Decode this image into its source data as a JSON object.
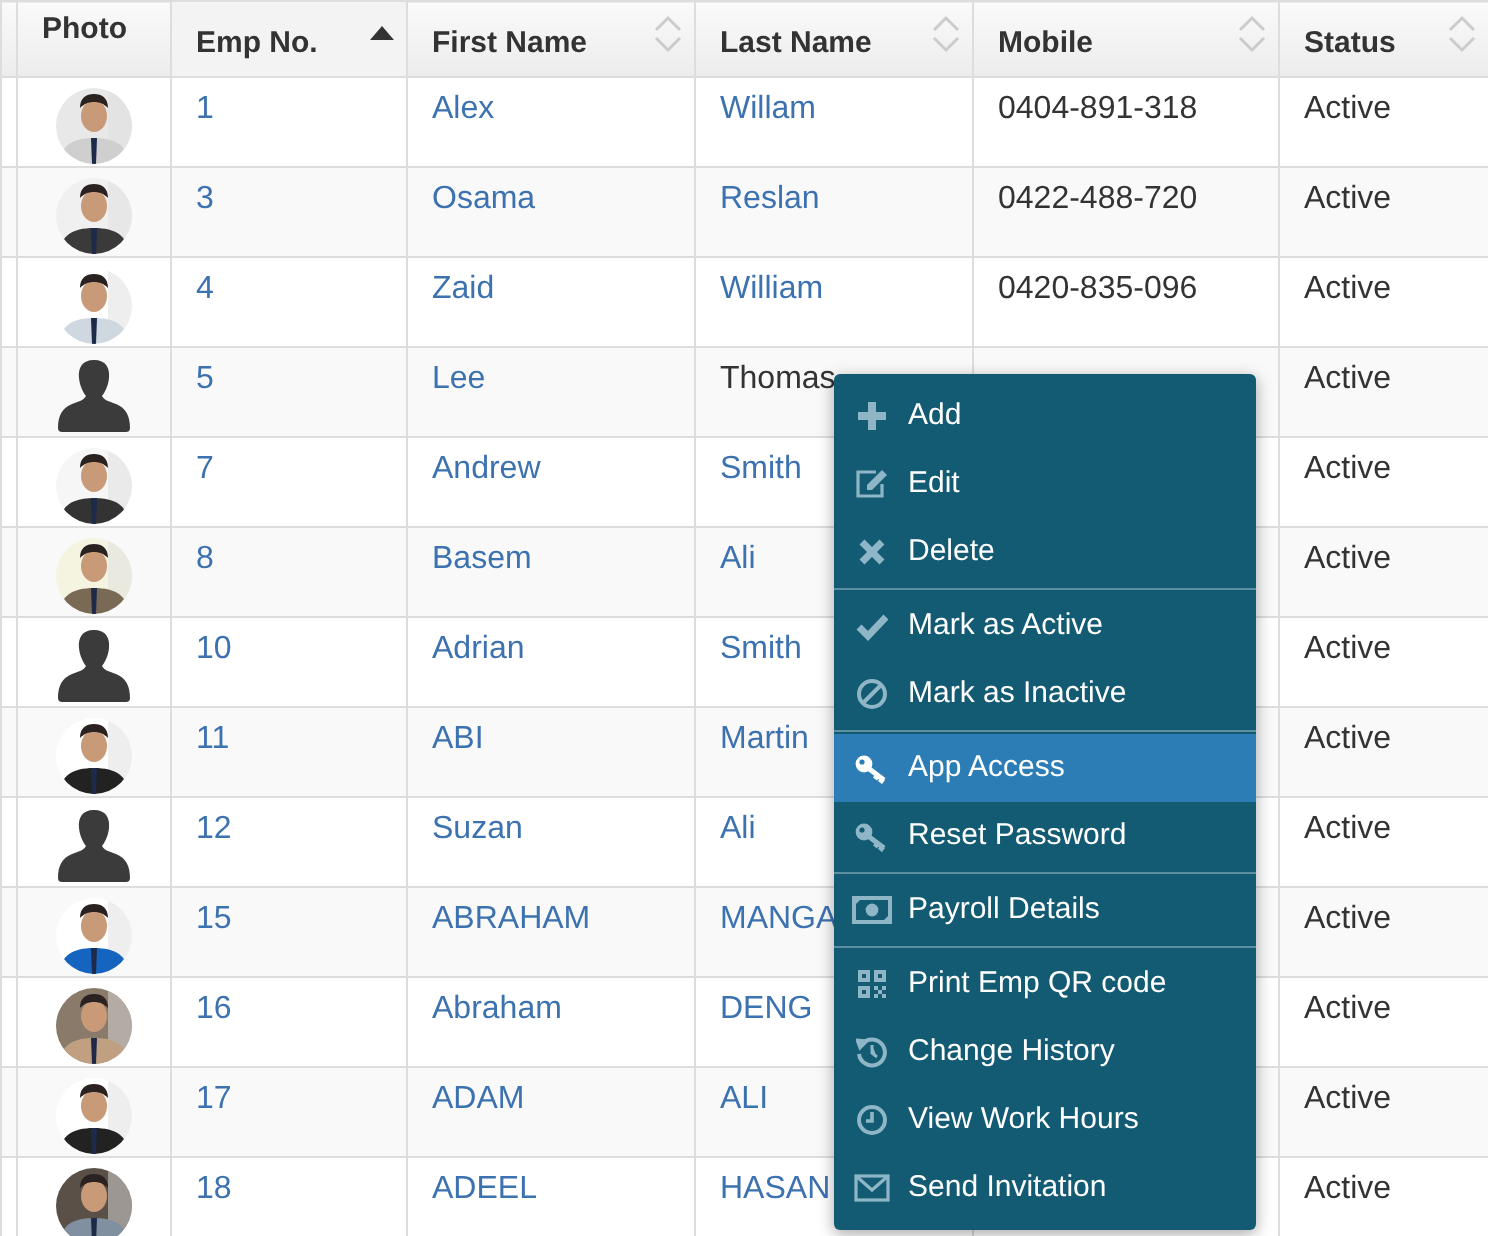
{
  "table": {
    "columns": [
      {
        "label": "Photo",
        "sortable": false
      },
      {
        "label": "Emp No.",
        "sortable": true,
        "sorted_ascending": true
      },
      {
        "label": "First Name",
        "sortable": true,
        "sorted_ascending": false
      },
      {
        "label": "Last Name",
        "sortable": true,
        "sorted_ascending": false
      },
      {
        "label": "Mobile",
        "sortable": true,
        "sorted_ascending": false
      },
      {
        "label": "Status",
        "sortable": true,
        "sorted_ascending": false
      }
    ],
    "rows": [
      {
        "has_photo": true,
        "emp_no": "1",
        "first_name": "Alex",
        "last_name": "Willam",
        "mobile": "0404-891-318",
        "status": "Active",
        "hovered": false
      },
      {
        "has_photo": true,
        "emp_no": "3",
        "first_name": "Osama",
        "last_name": "Reslan",
        "mobile": "0422-488-720",
        "status": "Active",
        "hovered": false
      },
      {
        "has_photo": true,
        "emp_no": "4",
        "first_name": "Zaid",
        "last_name": "William",
        "mobile": "0420-835-096",
        "status": "Active",
        "hovered": false
      },
      {
        "has_photo": false,
        "emp_no": "5",
        "first_name": "Lee",
        "last_name": "Thomas",
        "status": "Active",
        "hovered": true
      },
      {
        "has_photo": true,
        "emp_no": "7",
        "first_name": "Andrew",
        "last_name": "Smith",
        "status": "Active",
        "hovered": false
      },
      {
        "has_photo": true,
        "emp_no": "8",
        "first_name": "Basem",
        "last_name": "Ali",
        "status": "Active",
        "hovered": false
      },
      {
        "has_photo": false,
        "emp_no": "10",
        "first_name": "Adrian",
        "last_name": "Smith",
        "status": "Active",
        "hovered": false
      },
      {
        "has_photo": true,
        "emp_no": "11",
        "first_name": "ABI",
        "last_name": "Martin",
        "status": "Active",
        "hovered": false
      },
      {
        "has_photo": false,
        "emp_no": "12",
        "first_name": "Suzan",
        "last_name": "Ali",
        "status": "Active",
        "hovered": false
      },
      {
        "has_photo": true,
        "emp_no": "15",
        "first_name": "ABRAHAM",
        "last_name": "MANGA",
        "status": "Active",
        "hovered": false
      },
      {
        "has_photo": true,
        "emp_no": "16",
        "first_name": "Abraham",
        "last_name": "DENG",
        "status": "Active",
        "hovered": false
      },
      {
        "has_photo": true,
        "emp_no": "17",
        "first_name": "ADAM",
        "last_name": "ALI",
        "status": "Active",
        "hovered": false
      },
      {
        "has_photo": true,
        "emp_no": "18",
        "first_name": "ADEEL",
        "last_name": "HASAN",
        "status": "Active",
        "hovered": false
      }
    ]
  },
  "context_menu": {
    "groups": [
      [
        {
          "label": "Add",
          "selected": false
        },
        {
          "label": "Edit",
          "selected": false
        },
        {
          "label": "Delete",
          "selected": false
        }
      ],
      [
        {
          "label": "Mark as Active",
          "selected": false
        },
        {
          "label": "Mark as Inactive",
          "selected": false
        }
      ],
      [
        {
          "label": "App Access",
          "selected": true
        },
        {
          "label": "Reset Password",
          "selected": false
        }
      ],
      [
        {
          "label": "Payroll Details",
          "selected": false
        }
      ],
      [
        {
          "label": "Print Emp QR code",
          "selected": false
        },
        {
          "label": "Change History",
          "selected": false
        },
        {
          "label": "View Work Hours",
          "selected": false
        },
        {
          "label": "Send Invitation",
          "selected": false
        }
      ]
    ]
  }
}
